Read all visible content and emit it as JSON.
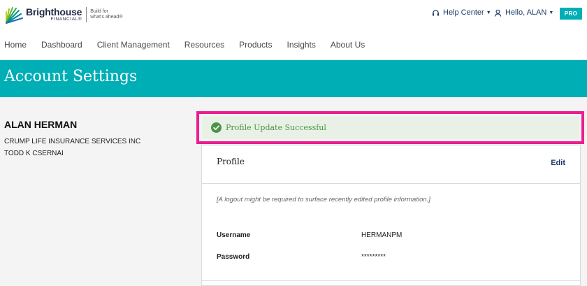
{
  "brand": {
    "name": "Brighthouse",
    "sub": "FINANCIAL®",
    "tagline_1": "Build for",
    "tagline_2": "what's ahead®"
  },
  "header": {
    "help_center": "Help Center",
    "greeting": "Hello, ALAN",
    "badge": "PRO"
  },
  "nav": [
    "Home",
    "Dashboard",
    "Client Management",
    "Resources",
    "Products",
    "Insights",
    "About Us"
  ],
  "page": {
    "title": "Account Settings"
  },
  "user": {
    "name": "ALAN HERMAN",
    "organization": "CRUMP LIFE INSURANCE SERVICES INC",
    "agent": "TODD K CSERNAI"
  },
  "alert": {
    "message": "Profile Update Successful",
    "color": "#4b9447"
  },
  "profile": {
    "title": "Profile",
    "edit_label": "Edit",
    "note": "[A logout might be required to surface recently edited profile information.]",
    "fields": [
      {
        "label": "Username",
        "value": "HERMANPM"
      },
      {
        "label": "Password",
        "value": "*********"
      }
    ]
  },
  "colors": {
    "accent": "#00aeb5",
    "highlight": "#ec1d8f",
    "link": "#1f3a66"
  }
}
